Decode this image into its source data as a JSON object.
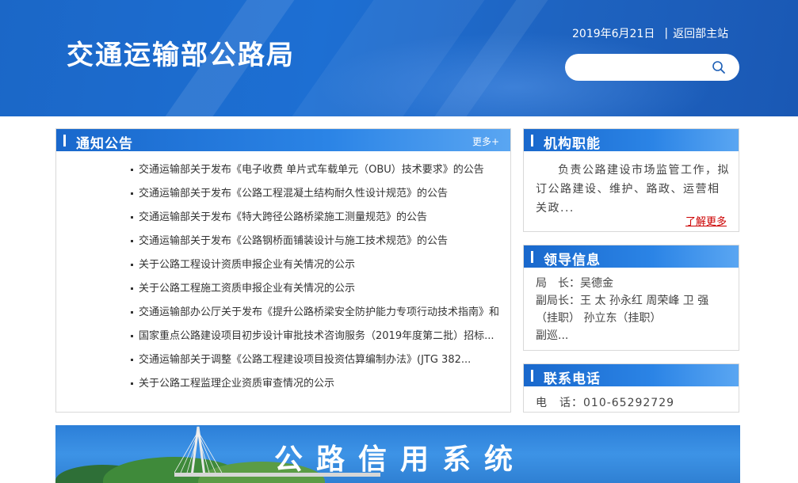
{
  "header": {
    "site_title": "交通运输部公路局",
    "date": "2019年6月21日",
    "separator": "|",
    "home_link": "返回部主站",
    "search_placeholder": "",
    "search_icon": "search-icon"
  },
  "notice": {
    "title": "通知公告",
    "more": "更多+",
    "items": [
      "交通运输部关于发布《电子收费 单片式车载单元（OBU）技术要求》的公告",
      "交通运输部关于发布《公路工程混凝土结构耐久性设计规范》的公告",
      "交通运输部关于发布《特大跨径公路桥梁施工测量规范》的公告",
      "交通运输部关于发布《公路钢桥面铺装设计与施工技术规范》的公告",
      "关于公路工程设计资质申报企业有关情况的公示",
      "关于公路工程施工资质申报企业有关情况的公示",
      "交通运输部办公厅关于发布《提升公路桥梁安全防护能力专项行动技术指南》和",
      "国家重点公路建设项目初步设计审批技术咨询服务（2019年度第二批）招标...",
      "交通运输部关于调整《公路工程建设项目投资估算编制办法》(JTG 382...",
      "关于公路工程监理企业资质审查情况的公示"
    ]
  },
  "functions": {
    "title": "机构职能",
    "text": "负责公路建设市场监管工作，拟订公路建设、维护、路政、运营相关政...",
    "more": "了解更多"
  },
  "leaders": {
    "title": "领导信息",
    "line1": "局　长：吴德金",
    "line2": "副局长：王 太 孙永红 周荣峰 卫 强（挂职） 孙立东（挂职）",
    "line3": "副巡..."
  },
  "contact": {
    "title": "联系电话",
    "phone": "电　话：010-65292729"
  },
  "banner": {
    "title": "公路信用系统"
  },
  "colors": {
    "header_blue": "#1d6fd3",
    "panel_blue": "#1968cc",
    "more_red": "#cc0000"
  }
}
